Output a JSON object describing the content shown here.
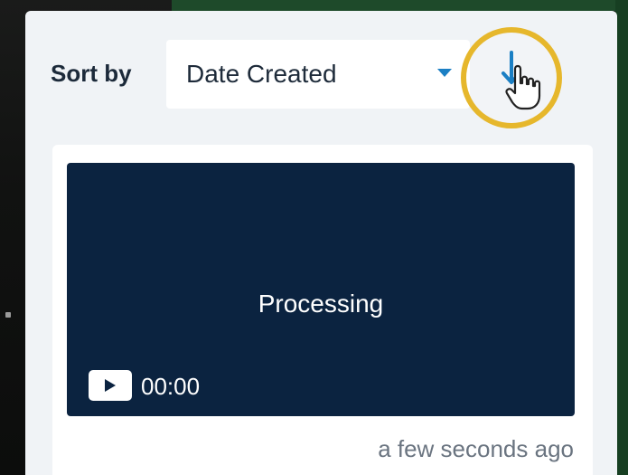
{
  "sort": {
    "label": "Sort by",
    "selected": "Date Created",
    "order_icon": "arrow-down-icon"
  },
  "cursor": {
    "icon": "hand-pointer-icon"
  },
  "colors": {
    "highlight_ring": "#e6b72c",
    "accent": "#1b7fc4",
    "thumbnail_bg": "#0b2340",
    "panel_bg": "#f0f3f6"
  },
  "video": {
    "status": "Processing",
    "duration": "00:00",
    "created": "a few seconds ago",
    "play_icon": "play-icon"
  }
}
